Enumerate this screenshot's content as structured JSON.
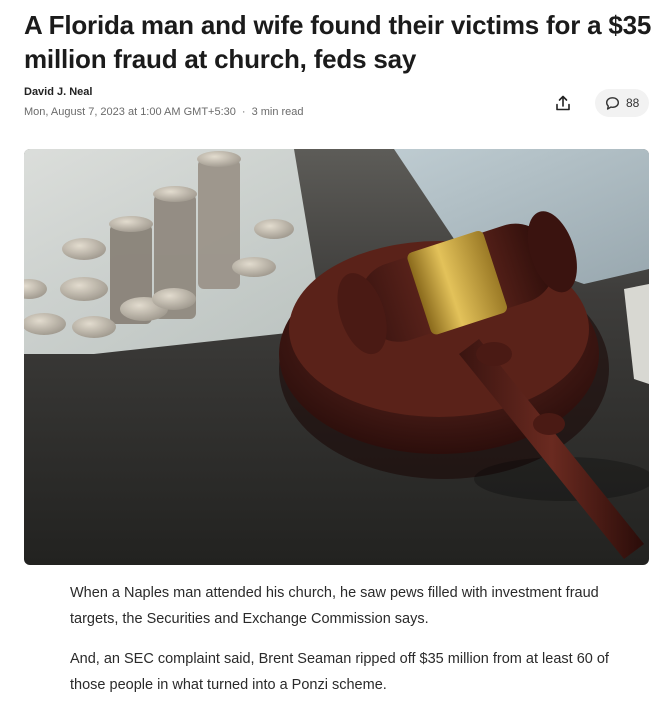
{
  "article": {
    "title": "A Florida man and wife found their victims for a $35 million fraud at church, feds say",
    "author": "David J. Neal",
    "date": "Mon, August 7, 2023 at 1:00 AM GMT+5:30",
    "separator": "·",
    "read_time": "3 min read",
    "comment_count": "88",
    "paragraphs": [
      "When a Naples man attended his church, he saw pews filled with investment fraud targets, the Securities and Exchange Commission says.",
      "And, an SEC complaint said, Brent Seaman ripped off $35 million from at least 60 of those people in what turned into a Ponzi scheme."
    ]
  },
  "icons": {
    "share": "share-icon",
    "comment": "comment-bubble-icon"
  }
}
